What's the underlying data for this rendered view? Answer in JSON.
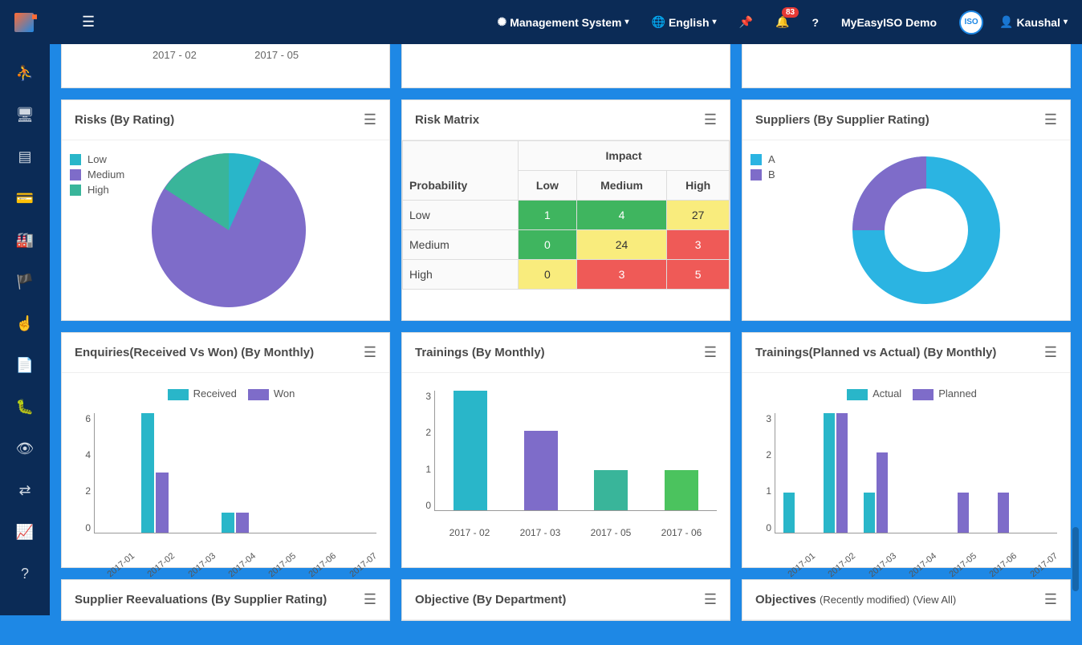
{
  "nav": {
    "mgmt_label": "Management System",
    "lang_label": "English",
    "notif_count": "83",
    "brand": "MyEasyISO Demo",
    "user": "Kaushal"
  },
  "peek_row": {
    "c1a": "2017 - 02",
    "c1b": "2017 - 05"
  },
  "panels": {
    "risks": {
      "title": "Risks",
      "sub": "(By Rating)"
    },
    "matrix": {
      "title": "Risk Matrix",
      "impact": "Impact",
      "prob": "Probability",
      "cols": {
        "low": "Low",
        "med": "Medium",
        "high": "High"
      },
      "rows": {
        "low": {
          "label": "Low",
          "v": [
            "1",
            "4",
            "27"
          ]
        },
        "med": {
          "label": "Medium",
          "v": [
            "0",
            "24",
            "3"
          ]
        },
        "high": {
          "label": "High",
          "v": [
            "0",
            "3",
            "5"
          ]
        }
      }
    },
    "suppliers": {
      "title": "Suppliers",
      "sub": "(By Supplier Rating)"
    },
    "enquiries": {
      "title": "Enquiries(Received Vs Won)",
      "sub": "(By Monthly)"
    },
    "trainings": {
      "title": "Trainings",
      "sub": "(By Monthly)"
    },
    "train_pa": {
      "title": "Trainings(Planned vs Actual)",
      "sub": "(By Monthly)"
    },
    "sup_reval": {
      "title": "Supplier Reevaluations",
      "sub": "(By Supplier Rating)"
    },
    "obj_dept": {
      "title": "Objective",
      "sub": "(By Department)"
    },
    "obj_recent": {
      "title": "Objectives",
      "sub1": "(Recently modified)",
      "sub2": "(View All)"
    }
  },
  "legends": {
    "risks": {
      "low": "Low",
      "med": "Medium",
      "high": "High"
    },
    "suppliers": {
      "a": "A",
      "b": "B"
    },
    "enquiries": {
      "r": "Received",
      "w": "Won"
    },
    "train_pa": {
      "a": "Actual",
      "p": "Planned"
    }
  },
  "colors": {
    "cyan": "#29b6c9",
    "purple": "#7e6cc9",
    "teal": "#39b59a",
    "green": "#4bc35e",
    "cyan2": "#2bb4e2",
    "purple2": "#7e6cc9"
  },
  "chart_data": [
    {
      "id": "risks_pie",
      "type": "pie",
      "title": "Risks (By Rating)",
      "series": [
        {
          "name": "Low",
          "value": 7,
          "color": "#29b6c9"
        },
        {
          "name": "Medium",
          "value": 75,
          "color": "#7e6cc9"
        },
        {
          "name": "High",
          "value": 18,
          "color": "#39b59a"
        }
      ]
    },
    {
      "id": "risk_matrix",
      "type": "heatmap",
      "title": "Risk Matrix",
      "rows": [
        "Low",
        "Medium",
        "High"
      ],
      "cols": [
        "Low",
        "Medium",
        "High"
      ],
      "xlabel": "Impact",
      "ylabel": "Probability",
      "values": [
        [
          1,
          4,
          27
        ],
        [
          0,
          24,
          3
        ],
        [
          0,
          3,
          5
        ]
      ]
    },
    {
      "id": "suppliers_donut",
      "type": "pie",
      "title": "Suppliers (By Supplier Rating)",
      "series": [
        {
          "name": "A",
          "value": 75,
          "color": "#2bb4e2"
        },
        {
          "name": "B",
          "value": 25,
          "color": "#7e6cc9"
        }
      ]
    },
    {
      "id": "enquiries",
      "type": "bar",
      "title": "Enquiries(Received Vs Won) (By Monthly)",
      "categories": [
        "2017-01",
        "2017-02",
        "2017-03",
        "2017-04",
        "2017-05",
        "2017-06",
        "2017-07"
      ],
      "series": [
        {
          "name": "Received",
          "values": [
            0,
            6,
            0,
            1,
            0,
            0,
            0
          ],
          "color": "#29b6c9"
        },
        {
          "name": "Won",
          "values": [
            0,
            3,
            0,
            1,
            0,
            0,
            0
          ],
          "color": "#7e6cc9"
        }
      ],
      "ylim": [
        0,
        6
      ]
    },
    {
      "id": "trainings",
      "type": "bar",
      "title": "Trainings (By Monthly)",
      "categories": [
        "2017 - 02",
        "2017 - 03",
        "2017 - 05",
        "2017 - 06"
      ],
      "values": [
        3,
        2,
        1,
        1
      ],
      "colors": [
        "#29b6c9",
        "#7e6cc9",
        "#39b59a",
        "#4bc35e"
      ],
      "ylim": [
        0,
        3
      ]
    },
    {
      "id": "trainings_pa",
      "type": "bar",
      "title": "Trainings(Planned vs Actual) (By Monthly)",
      "categories": [
        "2017-01",
        "2017-02",
        "2017-03",
        "2017-04",
        "2017-05",
        "2017-06",
        "2017-07"
      ],
      "series": [
        {
          "name": "Actual",
          "values": [
            1,
            3,
            1,
            0,
            0,
            0,
            0
          ],
          "color": "#29b6c9"
        },
        {
          "name": "Planned",
          "values": [
            0,
            3,
            2,
            0,
            1,
            1,
            0
          ],
          "color": "#7e6cc9"
        }
      ],
      "ylim": [
        0,
        3
      ]
    }
  ]
}
